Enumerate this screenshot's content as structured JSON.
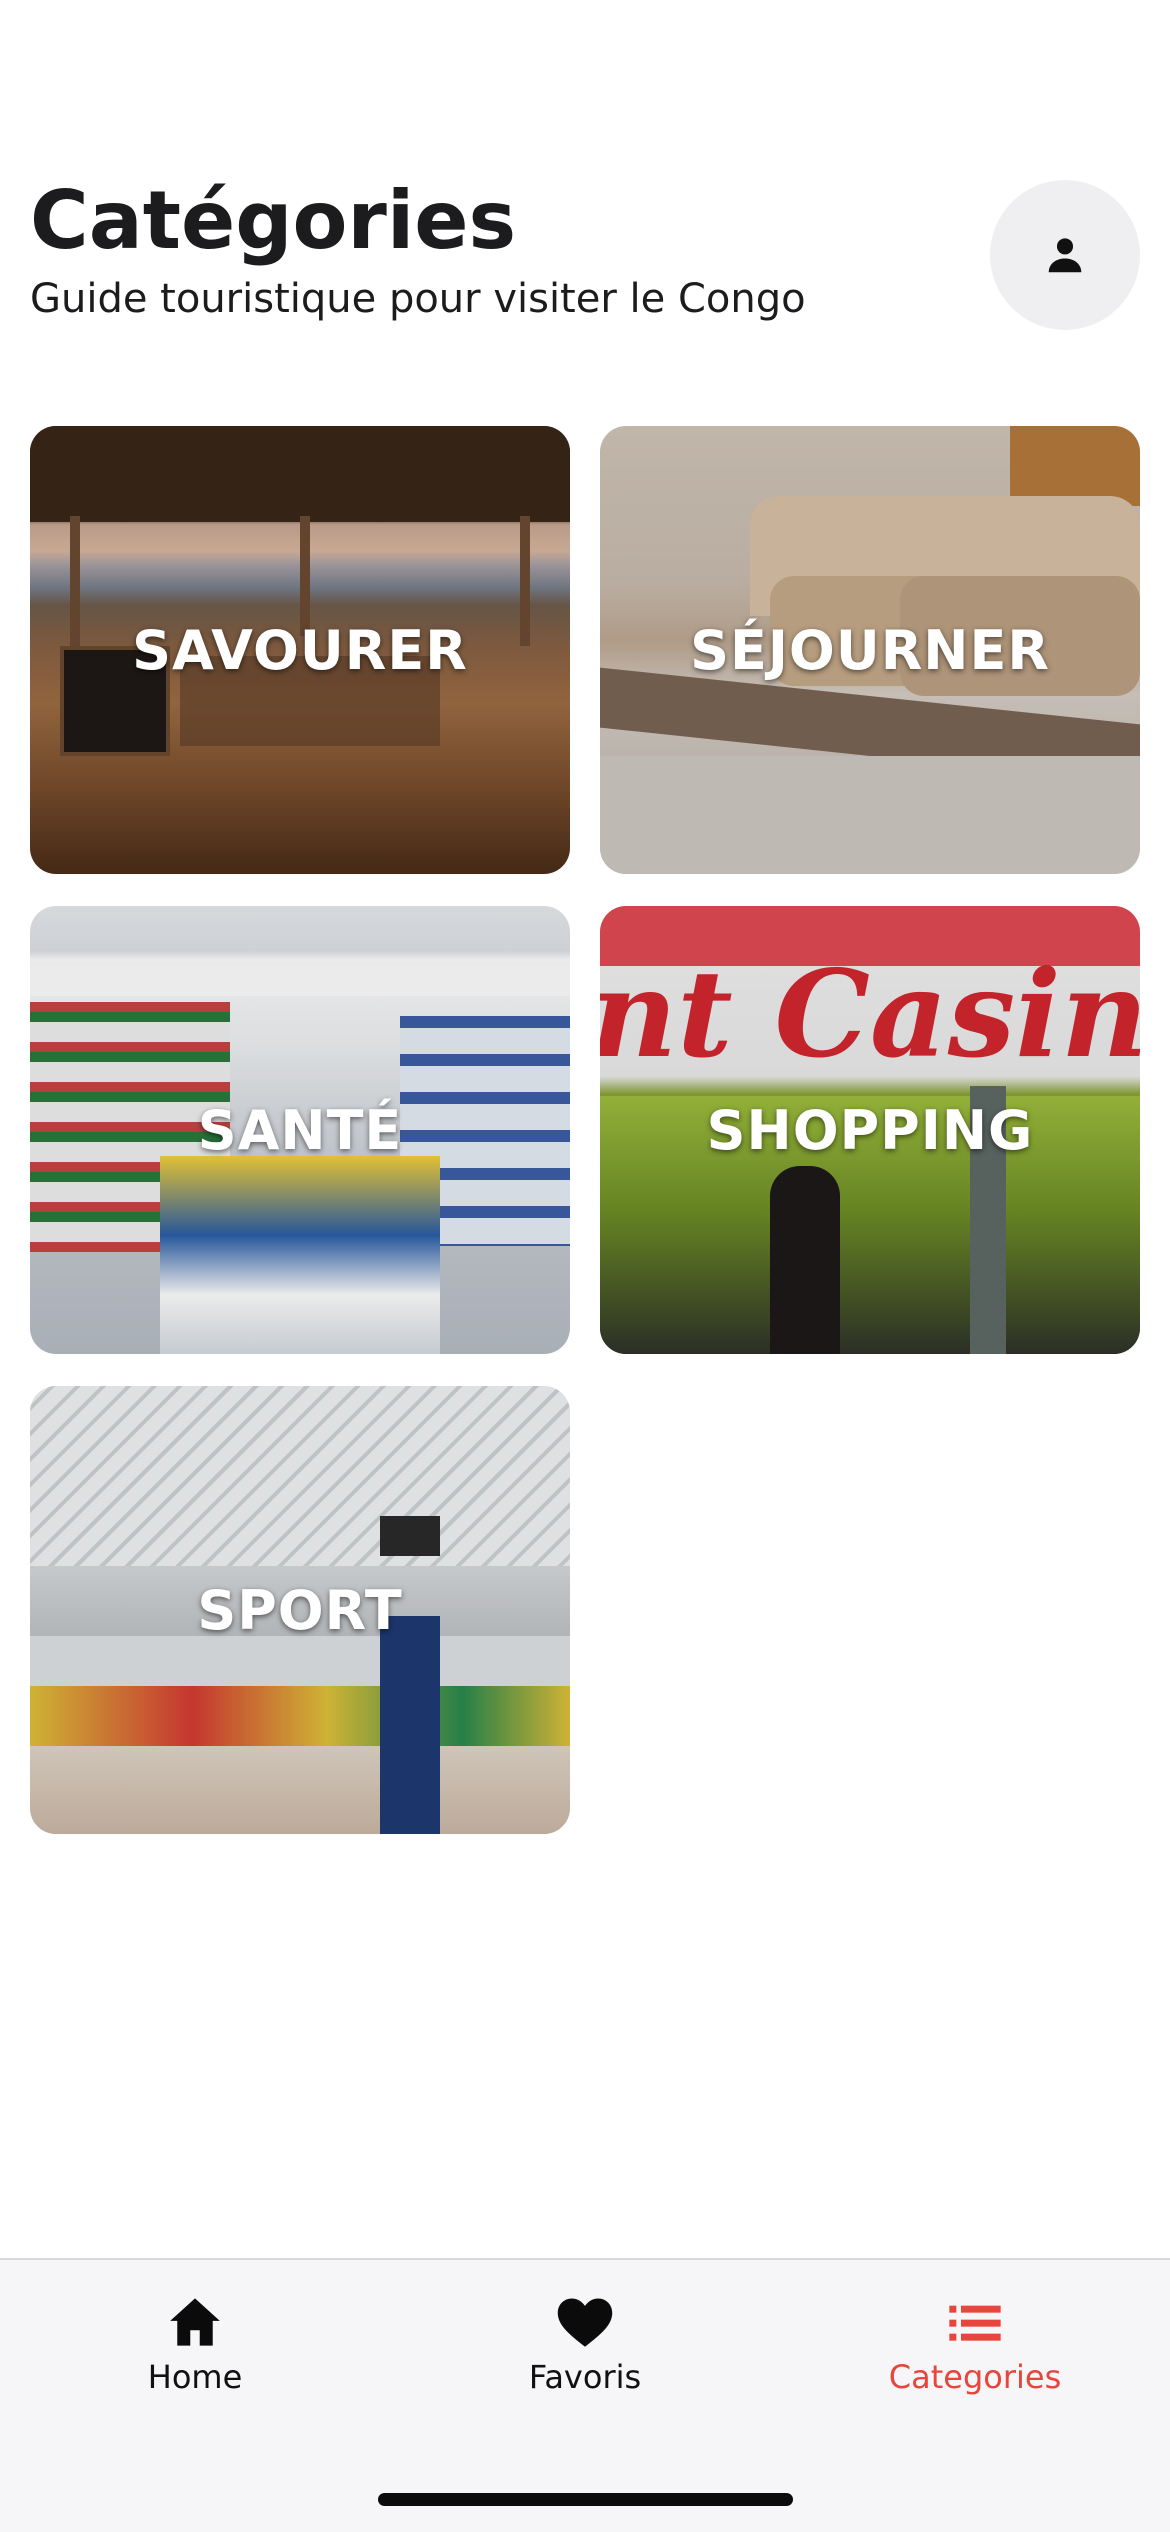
{
  "header": {
    "title": "Catégories",
    "subtitle": "Guide touristique pour visiter le Congo"
  },
  "profile": {
    "icon": "person-icon"
  },
  "categories": [
    {
      "label": "SAVOURER",
      "image": "restaurant terrace by the sea"
    },
    {
      "label": "SÉJOURNER",
      "image": "hotel bed with pillows"
    },
    {
      "label": "SANTÉ",
      "image": "pharmacy shelves"
    },
    {
      "label": "SHOPPING",
      "image": "Casino supermarket entrance"
    },
    {
      "label": "SPORT",
      "image": "indoor sports arena"
    }
  ],
  "tabbar": {
    "items": [
      {
        "label": "Home",
        "icon": "home-icon"
      },
      {
        "label": "Favoris",
        "icon": "heart-icon"
      },
      {
        "label": "Categories",
        "icon": "list-icon"
      }
    ]
  },
  "colors": {
    "accent": "#e8453c",
    "text": "#1c1c1e",
    "tabbar_bg": "#f6f6f8"
  }
}
